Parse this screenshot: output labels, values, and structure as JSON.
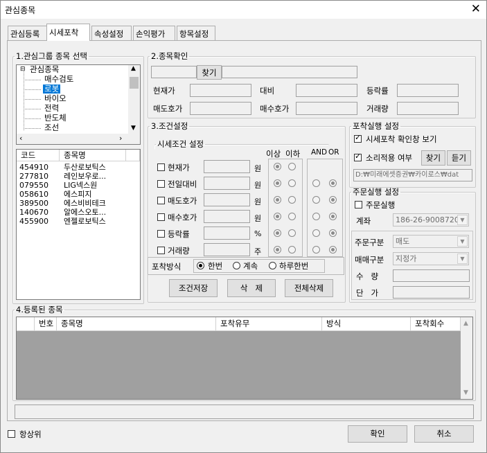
{
  "window": {
    "title": "관심종목",
    "close": "✕"
  },
  "tabs": [
    "관심등록",
    "시세포착",
    "속성설정",
    "손익평가",
    "항목설정"
  ],
  "group1": {
    "legend": "1.관심그룹 종목 선택",
    "tree": {
      "root_toggle": "⊟",
      "root": "관심종목",
      "items": [
        "매수검토",
        "로봇",
        "바이오",
        "전력",
        "반도체",
        "조선"
      ],
      "selected": "로봇"
    },
    "list_headers": [
      "코드",
      "종목명"
    ],
    "rows": [
      {
        "code": "454910",
        "name": "두산로보틱스"
      },
      {
        "code": "277810",
        "name": "레인보우로..."
      },
      {
        "code": "079550",
        "name": "LIG넥스원"
      },
      {
        "code": "058610",
        "name": "에스피지"
      },
      {
        "code": "389500",
        "name": "에스비비테크"
      },
      {
        "code": "140670",
        "name": "알에스오토..."
      },
      {
        "code": "455900",
        "name": "엔젤로보틱스"
      }
    ]
  },
  "group2": {
    "legend": "2.종목확인",
    "find": "찾기",
    "labels": {
      "current": "현재가",
      "diff": "대비",
      "rate": "등락률",
      "ask": "매도호가",
      "bid": "매수호가",
      "volume": "거래량"
    }
  },
  "group3": {
    "legend": "3.조건설정",
    "sub_legend": "시세조건 설정",
    "col1": "이상",
    "col2": "이하",
    "col3": "AND",
    "col4": "OR",
    "conditions": [
      {
        "label": "현재가",
        "unit": "원"
      },
      {
        "label": "전일대비",
        "unit": "원"
      },
      {
        "label": "매도호가",
        "unit": "원"
      },
      {
        "label": "매수호가",
        "unit": "원"
      },
      {
        "label": "등락률",
        "unit": "%"
      },
      {
        "label": "거래량",
        "unit": "주"
      }
    ],
    "mode_label": "포착방식",
    "modes": [
      "한번",
      "계속",
      "하루한번"
    ],
    "mode_selected": "한번",
    "btn_save": "조건저장",
    "btn_delete": "삭   제",
    "btn_delete_all": "전체삭제"
  },
  "catch": {
    "legend": "포착실행 설정",
    "confirm": "시세포착 확인창 보기",
    "sound": "소리적용 여부",
    "find": "찾기",
    "listen": "듣기",
    "path": "D:₩미래에셋증권₩카이로스₩dat"
  },
  "order": {
    "legend": "주문실행 설정",
    "exec": "주문실행",
    "account_label": "계좌",
    "account": "186-26-9008720",
    "type_label": "주문구분",
    "type": "매도",
    "trade_label": "매매구분",
    "trade": "지정가",
    "qty_label": "수   량",
    "price_label": "단   가"
  },
  "group4": {
    "legend": "4.등록된 종목",
    "headers": [
      "번호",
      "종목명",
      "포착유무",
      "방식",
      "포착회수"
    ]
  },
  "footer": {
    "topmost": "항상위",
    "ok": "확인",
    "cancel": "취소"
  },
  "colors": {
    "selected": "#0078d7",
    "grid_bg": "#a0a0a0"
  }
}
